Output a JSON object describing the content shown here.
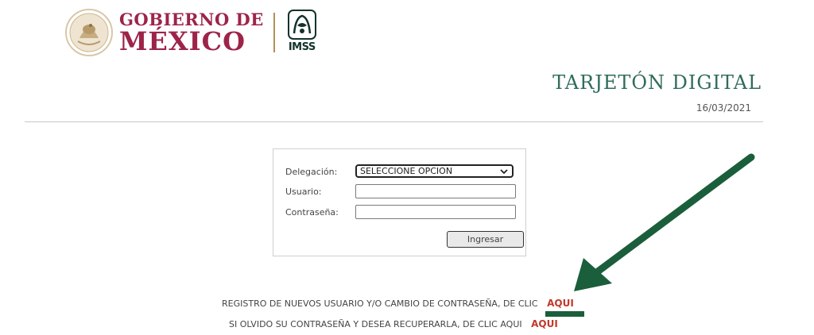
{
  "header": {
    "gob_line1": "GOBIERNO DE",
    "gob_line2": "MÉXICO",
    "imss_label": "IMSS"
  },
  "page": {
    "title": "TARJETÓN DIGITAL",
    "date": "16/03/2021"
  },
  "form": {
    "delegacion_label": "Delegación:",
    "delegacion_value": "SELECCIONE OPCION",
    "usuario_label": "Usuario:",
    "usuario_value": "",
    "contrasena_label": "Contraseña:",
    "contrasena_value": "",
    "submit_label": "Ingresar"
  },
  "links": {
    "registro_text": "REGISTRO DE NUEVOS USUARIO Y/O CAMBIO DE CONTRASEÑA, DE CLIC",
    "registro_link": "AQUI",
    "recuperar_text": "SI OLVIDO SU CONTRASEÑA Y DESEA RECUPERARLA, DE CLIC AQUI",
    "recuperar_link": "AQUI"
  },
  "colors": {
    "gob_red": "#9d2449",
    "title_green": "#2f6c5b",
    "link_red": "#c0392b",
    "arrow_green": "#1b5e3b",
    "gold": "#b38e5d"
  },
  "icons": [
    "mexico-seal-icon",
    "imss-logo-icon",
    "chevron-down-icon",
    "annotation-arrow-icon"
  ]
}
